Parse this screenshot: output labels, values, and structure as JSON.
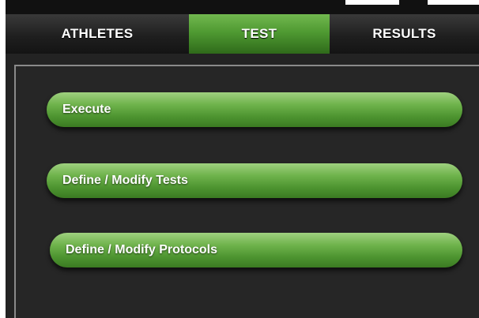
{
  "tabs": [
    {
      "label": "ATHLETES",
      "active": false
    },
    {
      "label": "TEST",
      "active": true
    },
    {
      "label": "RESULTS",
      "active": false
    }
  ],
  "menu": {
    "execute": "Execute",
    "define_tests": "Define / Modify Tests",
    "define_protocols": "Define / Modify Protocols"
  },
  "colors": {
    "accent_green": "#4f9a32",
    "panel_bg": "#232323",
    "tabbar_bg": "#1f1f1f"
  }
}
